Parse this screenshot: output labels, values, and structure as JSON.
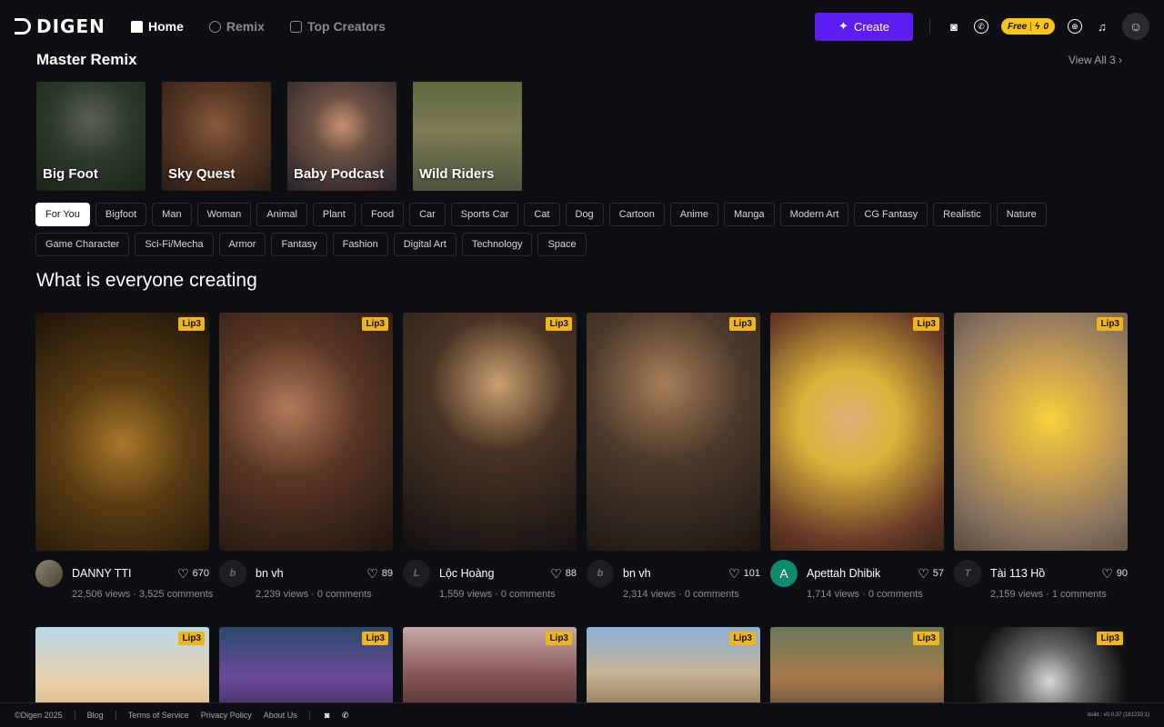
{
  "brand": {
    "name": "DIGEN"
  },
  "nav": [
    {
      "label": "Home",
      "icon": "home-icon",
      "active": true
    },
    {
      "label": "Remix",
      "icon": "remix-icon",
      "active": false
    },
    {
      "label": "Top Creators",
      "icon": "creators-icon",
      "active": false
    }
  ],
  "header": {
    "create_label": "Create",
    "free_label": "Free",
    "credits": "0",
    "accent": "#5b1df0",
    "badge_color": "#f5c518"
  },
  "master_remix": {
    "title": "Master Remix",
    "view_all": "View All 3",
    "items": [
      {
        "label": "Big Foot"
      },
      {
        "label": "Sky Quest"
      },
      {
        "label": "Baby Podcast"
      },
      {
        "label": "Wild Riders"
      }
    ]
  },
  "tags": [
    "For You",
    "Bigfoot",
    "Man",
    "Woman",
    "Animal",
    "Plant",
    "Food",
    "Car",
    "Sports Car",
    "Cat",
    "Dog",
    "Cartoon",
    "Anime",
    "Manga",
    "Modern Art",
    "CG Fantasy",
    "Realistic",
    "Nature",
    "Game Character",
    "Sci-Fi/Mecha",
    "Armor",
    "Fantasy",
    "Fashion",
    "Digital Art",
    "Technology",
    "Space"
  ],
  "active_tag": "For You",
  "feed": {
    "title": "What is everyone creating",
    "cards": [
      {
        "badge": "Lip3",
        "name": "DANNY TTI",
        "avatar": "",
        "likes": "670",
        "stats": "22,506 views · 3,525 comments"
      },
      {
        "badge": "Lip3",
        "name": "bn vh",
        "avatar": "b",
        "likes": "89",
        "stats": "2,239 views · 0 comments"
      },
      {
        "badge": "Lip3",
        "name": "Lộc Hoàng",
        "avatar": "L",
        "likes": "88",
        "stats": "1,559 views · 0 comments"
      },
      {
        "badge": "Lip3",
        "name": "bn vh",
        "avatar": "b",
        "likes": "101",
        "stats": "2,314 views · 0 comments"
      },
      {
        "badge": "Lip3",
        "name": "Apettah Dhibik",
        "avatar": "A",
        "likes": "57",
        "stats": "1,714 views · 0 comments"
      },
      {
        "badge": "Lip3",
        "name": "Tài 113 Hồ",
        "avatar": "T",
        "likes": "90",
        "stats": "2,159 views · 1 comments"
      }
    ],
    "second_row_badges": [
      "Lip3",
      "Lip3",
      "Lip3",
      "Lip3",
      "Lip3",
      "Lip3"
    ]
  },
  "footer": {
    "copyright": "©Digen 2025",
    "links": [
      "Blog",
      "Terms of Service",
      "Privacy Policy",
      "About Us"
    ],
    "build": "build : v0.0.37 (181230.1)"
  }
}
